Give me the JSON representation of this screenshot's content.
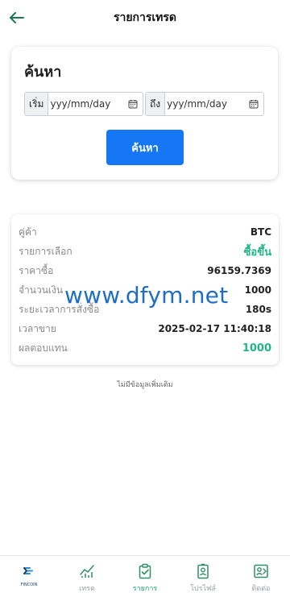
{
  "header": {
    "title": "รายการเทรด"
  },
  "search": {
    "title": "ค้นหา",
    "start_label": "เริ่ม",
    "end_label": "ถึง",
    "start_placeholder": "yyy/mm/day",
    "end_placeholder": "yyy/mm/day",
    "button_label": "ค้นหา"
  },
  "trade": {
    "rows": [
      {
        "label": "คู่ค้า",
        "value": "BTC"
      },
      {
        "label": "รายการเลือก",
        "value": "ซื้อขึ้น"
      },
      {
        "label": "ราคาซื้อ",
        "value": "96159.7369"
      },
      {
        "label": "จำนวนเงิน",
        "value": "1000"
      },
      {
        "label": "ระยะเวลาการสั่งซื้อ",
        "value": "180s"
      },
      {
        "label": "เวลาขาย",
        "value": "2025-02-17 11:40:18"
      },
      {
        "label": "ผลตอบแทน",
        "value": "1000"
      }
    ]
  },
  "watermark": "www.dfym.net",
  "footer_note": "ไม่มีข้อมูลเพิ่มเติม",
  "tabbar": {
    "logo_text": "FINCOIN",
    "items": [
      {
        "label": "เทรด",
        "icon": "chart-icon"
      },
      {
        "label": "รายการ",
        "icon": "clipboard-check-icon"
      },
      {
        "label": "โปรไฟล์",
        "icon": "badge-icon"
      },
      {
        "label": "ติดต่อ",
        "icon": "contact-icon"
      }
    ],
    "active": "รายการ"
  },
  "colors": {
    "accent": "#1677f5",
    "green": "#20b486",
    "header_icon": "#1a7a4c"
  }
}
